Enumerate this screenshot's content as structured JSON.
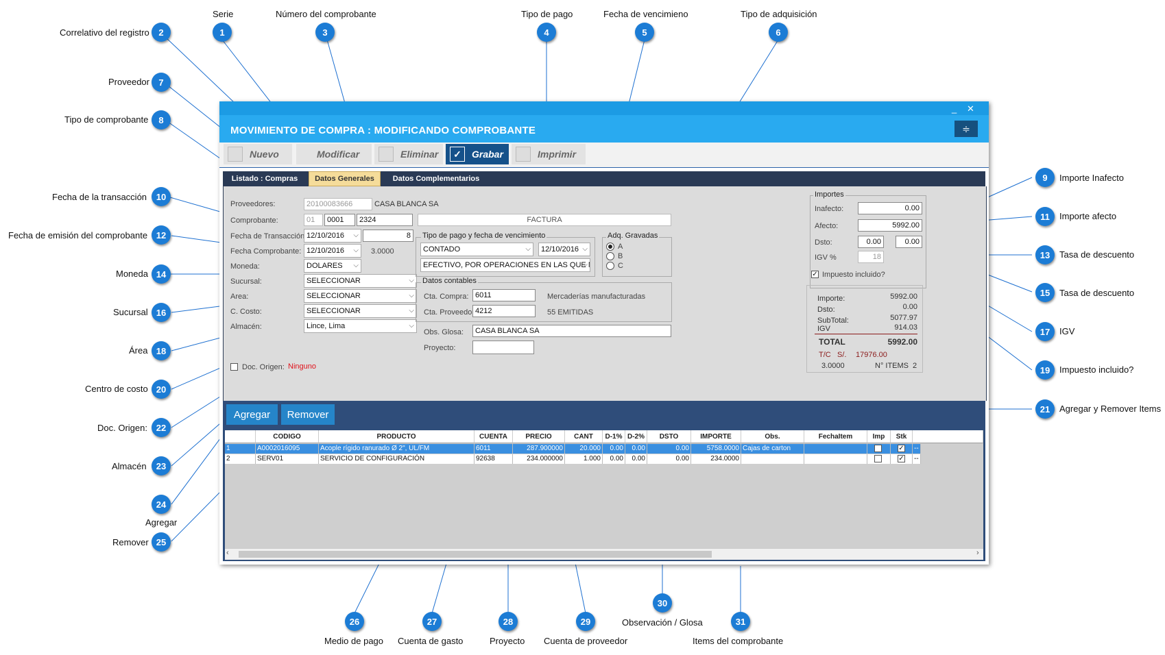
{
  "callouts": [
    {
      "n": "1",
      "label": "Serie"
    },
    {
      "n": "2",
      "label": "Correlativo del registro"
    },
    {
      "n": "3",
      "label": "Número del comprobante"
    },
    {
      "n": "4",
      "label": "Tipo de pago"
    },
    {
      "n": "5",
      "label": "Fecha de vencimieno"
    },
    {
      "n": "6",
      "label": "Tipo de adquisición"
    },
    {
      "n": "7",
      "label": "Proveedor"
    },
    {
      "n": "8",
      "label": "Tipo de comprobante"
    },
    {
      "n": "9",
      "label": "Importe Inafecto"
    },
    {
      "n": "10",
      "label": "Fecha de la transacción"
    },
    {
      "n": "11",
      "label": "Importe afecto"
    },
    {
      "n": "12",
      "label": "Fecha de emisión del comprobante"
    },
    {
      "n": "13",
      "label": "Tasa de descuento"
    },
    {
      "n": "14",
      "label": "Moneda"
    },
    {
      "n": "15",
      "label": "Tasa de descuento"
    },
    {
      "n": "16",
      "label": "Sucursal"
    },
    {
      "n": "17",
      "label": "IGV"
    },
    {
      "n": "18",
      "label": "Área"
    },
    {
      "n": "19",
      "label": "Impuesto incluido?"
    },
    {
      "n": "20",
      "label": "Centro de costo"
    },
    {
      "n": "21",
      "label": "Agregar y Remover Items"
    },
    {
      "n": "22",
      "label": "Doc. Origen:"
    },
    {
      "n": "23",
      "label": "Almacén"
    },
    {
      "n": "24",
      "label": "Agregar"
    },
    {
      "n": "25",
      "label": "Remover"
    },
    {
      "n": "26",
      "label": "Medio de pago"
    },
    {
      "n": "27",
      "label": "Cuenta de gasto"
    },
    {
      "n": "28",
      "label": "Proyecto"
    },
    {
      "n": "29",
      "label": "Cuenta de proveedor"
    },
    {
      "n": "30",
      "label": "Observación / Glosa"
    },
    {
      "n": "31",
      "label": "Items del comprobante"
    }
  ],
  "window": {
    "title": "MOVIMIENTO DE COMPRA : MODIFICANDO COMPROBANTE",
    "minimize": "_",
    "close": "✕",
    "menu_icon": "≑"
  },
  "toolbar": {
    "nuevo": "Nuevo",
    "modificar": "Modificar",
    "eliminar": "Eliminar",
    "grabar": "Grabar",
    "imprimir": "Imprimir"
  },
  "tabs": {
    "listado": "Listado : Compras",
    "generales": "Datos Generales",
    "complementarios": "Datos Complementarios"
  },
  "form": {
    "proveedores_label": "Proveedores:",
    "proveedor_ruc": "20100083666",
    "proveedor_nombre": "CASA BLANCA SA",
    "comprobante_label": "Comprobante:",
    "tipo_comp": "01",
    "serie": "0001",
    "numero": "2324",
    "tipo_comp_nombre": "FACTURA",
    "fecha_trans_label": "Fecha de Transacción:",
    "fecha_trans": "12/10/2016",
    "correlativo": "8",
    "fecha_comp_label": "Fecha Comprobante:",
    "fecha_comp": "12/10/2016",
    "tipo_cambio": "3.0000",
    "moneda_label": "Moneda:",
    "moneda": "DOLARES",
    "sucursal_label": "Sucursal:",
    "sucursal": "SELECCIONAR",
    "area_label": "Area:",
    "area": "SELECCIONAR",
    "ccosto_label": "C. Costo:",
    "ccosto": "SELECCIONAR",
    "almacen_label": "Almacén:",
    "almacen": "Lince, Lima",
    "doc_origen_label": "Doc. Origen:",
    "doc_origen_value": "Ninguno",
    "pago_group": "Tipo de pago y fecha de vencimiento",
    "tipo_pago": "CONTADO",
    "fecha_venc": "12/10/2016",
    "medio_pago": "EFECTIVO, POR OPERACIONES EN LAS QUE NO",
    "adq_group": "Adq. Gravadas",
    "adq_a": "A",
    "adq_b": "B",
    "adq_c": "C",
    "contables_group": "Datos contables",
    "cta_compra_label": "Cta. Compra:",
    "cta_compra": "6011",
    "cta_compra_desc": "Mercaderías manufacturadas",
    "cta_prov_label": "Cta. Proveedor:",
    "cta_prov": "4212",
    "cta_prov_desc": "55 EMITIDAS",
    "glosa_label": "Obs. Glosa:",
    "glosa": "CASA BLANCA SA",
    "proyecto_label": "Proyecto:",
    "proyecto": ""
  },
  "importes": {
    "group": "Importes",
    "inafecto_label": "Inafecto:",
    "inafecto": "0.00",
    "afecto_label": "Afecto:",
    "afecto": "5992.00",
    "dsto_label": "Dsto:",
    "dsto1": "0.00",
    "dsto2": "0.00",
    "igv_label": "IGV %",
    "igv": "18",
    "impuesto_incluido": "Impuesto incluido?",
    "importe_label": "Importe:",
    "importe": "5992.00",
    "dsto_sum_label": "Dsto:",
    "dsto_sum": "0.00",
    "subtotal_label": "SubTotal:",
    "subtotal": "5077.97",
    "igv_sum_label": "IGV",
    "igv_sum": "914.03",
    "total_label": "TOTAL",
    "total": "5992.00",
    "tc_label": "T/C",
    "soles_label": "S/.",
    "soles": "17976.00",
    "tc": "3.0000",
    "items_label": "N° ITEMS",
    "items": "2"
  },
  "buttons": {
    "agregar": "Agregar",
    "remover": "Remover"
  },
  "grid": {
    "headers": [
      "CODIGO",
      "PRODUCTO",
      "CUENTA",
      "PRECIO",
      "CANT",
      "D-1%",
      "D-2%",
      "DSTO",
      "IMPORTE",
      "Obs.",
      "FechaItem",
      "Imp",
      "Stk"
    ],
    "rows": [
      {
        "n": "1",
        "codigo": "A0002016095",
        "producto": "Acople rígido ranurado Ø 2\", UL/FM",
        "cuenta": "6011",
        "precio": "287.900000",
        "cant": "20.000",
        "d1": "0.00",
        "d2": "0.00",
        "dsto": "0.00",
        "importe": "5758.0000",
        "obs": "Cajas de carton",
        "fecha": "",
        "extra": "--"
      },
      {
        "n": "2",
        "codigo": "SERV01",
        "producto": "SERVICIO DE CONFIGURACIÓN",
        "cuenta": "92638",
        "precio": "234.000000",
        "cant": "1.000",
        "d1": "0.00",
        "d2": "0.00",
        "dsto": "0.00",
        "importe": "234.0000",
        "obs": "",
        "fecha": "",
        "extra": "--"
      }
    ]
  }
}
